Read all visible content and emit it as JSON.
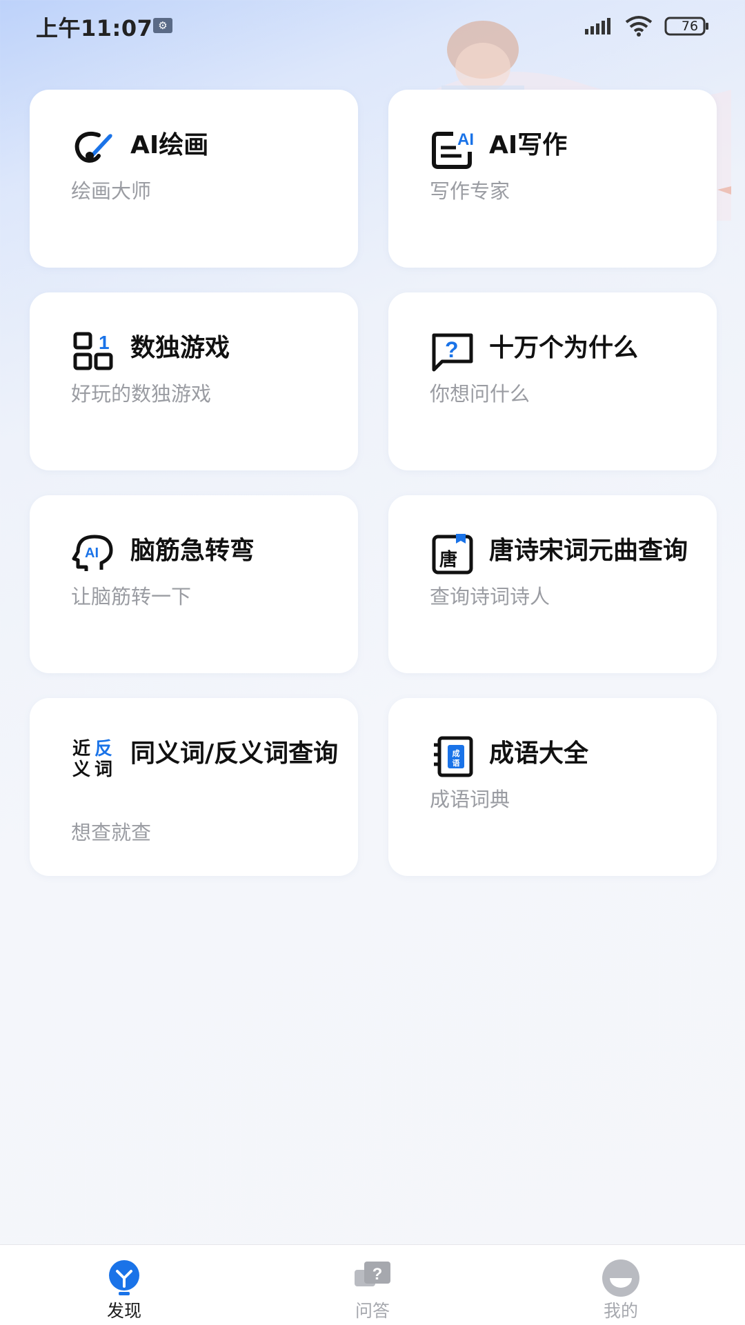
{
  "status_bar": {
    "time": "上午11:07",
    "battery": "76"
  },
  "cards": [
    {
      "title": "AI绘画",
      "subtitle": "绘画大师",
      "icon": "paintbrush-ai-icon"
    },
    {
      "title": "AI写作",
      "subtitle": "写作专家",
      "icon": "document-ai-icon"
    },
    {
      "title": "数独游戏",
      "subtitle": "好玩的数独游戏",
      "icon": "sudoku-grid-icon"
    },
    {
      "title": "十万个为什么",
      "subtitle": "你想问什么",
      "icon": "question-bubble-icon"
    },
    {
      "title": "脑筋急转弯",
      "subtitle": "让脑筋转一下",
      "icon": "ai-head-icon"
    },
    {
      "title": "唐诗宋词元曲查询",
      "subtitle": "查询诗词诗人",
      "icon": "tang-book-icon"
    },
    {
      "title": "同义词/反义词查询",
      "subtitle": "想查就查",
      "icon": "synonym-antonym-icon",
      "icon_text": [
        "近",
        "反",
        "义",
        "词"
      ]
    },
    {
      "title": "成语大全",
      "subtitle": "成语词典",
      "icon": "idiom-book-icon",
      "icon_text": "成语"
    }
  ],
  "bottom_nav": [
    {
      "label": "发现",
      "icon": "discover-bulb-icon",
      "active": true
    },
    {
      "label": "问答",
      "icon": "qa-chat-icon",
      "active": false
    },
    {
      "label": "我的",
      "icon": "profile-icon",
      "active": false
    }
  ],
  "colors": {
    "accent": "#1a73e8",
    "title_text": "#111111",
    "subtitle_text": "#9a9ca2",
    "nav_inactive": "#a6a8ae"
  }
}
